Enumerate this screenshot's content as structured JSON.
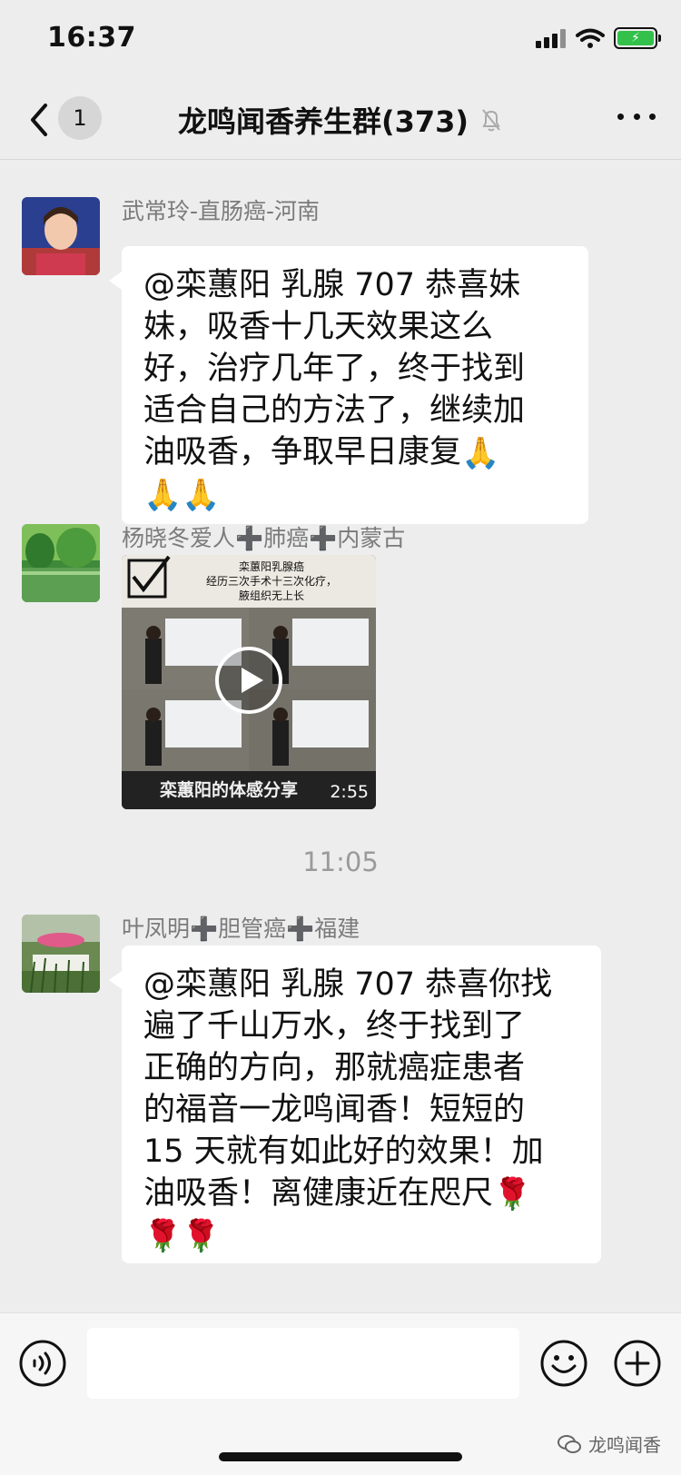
{
  "status_bar": {
    "time": "16:37"
  },
  "header": {
    "back_badge": "1",
    "title": "龙鸣闻香养生群(373)",
    "mute_icon": "bell-slash-icon",
    "more_icon": "more-horizontal-icon"
  },
  "messages": [
    {
      "sender": "武常玲-直肠癌-河南",
      "lines": [
        "@栾蕙阳 乳腺 707 恭喜妹",
        "妹，吸香十几天效果这么",
        "好，治疗几年了，终于找到",
        "适合自己的方法了，继续加",
        "油吸香，争取早日康复"
      ],
      "emoji_inline": "🙏",
      "emoji_tail": "🙏🙏"
    },
    {
      "sender": "杨晓冬爱人➕肺癌➕内蒙古",
      "video": {
        "caption_top": "栾蕙阳乳腺癌",
        "caption_line2": "经历三次手术十三次化疗，",
        "caption_line3": "腋组织无上长",
        "caption_bottom": "栾蕙阳的体感分享",
        "duration": "2:55"
      }
    },
    {
      "time": "11:05"
    },
    {
      "sender": "叶凤明➕胆管癌➕福建",
      "lines": [
        "@栾蕙阳 乳腺 707 恭喜你找",
        "遍了千山万水，终于找到了",
        "正确的方向，那就癌症患者",
        "的福音一龙鸣闻香！短短的",
        "15 天就有如此好的效果！加",
        "油吸香！离健康近在咫尺"
      ],
      "emoji_inline": "🌹",
      "emoji_tail": "🌹🌹"
    }
  ],
  "input_bar": {
    "voice_icon": "voice-icon",
    "emoji_icon": "emoji-icon",
    "plus_icon": "plus-icon",
    "input_value": ""
  },
  "watermark": {
    "text": "龙鸣闻香"
  },
  "colors": {
    "background": "#ededed",
    "bubble": "#ffffff",
    "sender": "#7b7b7b",
    "time_label": "#9a9a9a",
    "battery": "#33c14b"
  }
}
